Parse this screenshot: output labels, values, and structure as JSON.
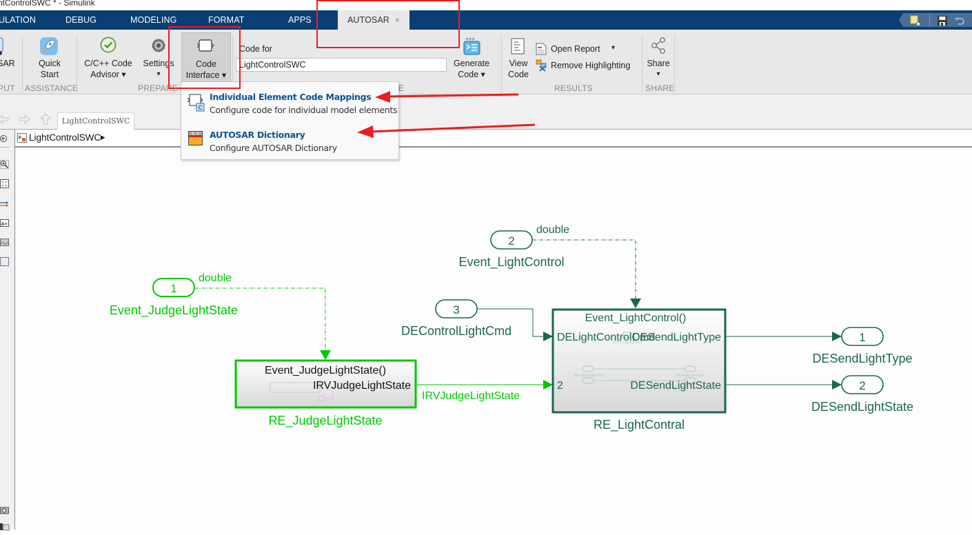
{
  "window": {
    "title": "ntControlSWC * - Simulink"
  },
  "tabs": [
    {
      "label": "ULATION"
    },
    {
      "label": "DEBUG"
    },
    {
      "label": "MODELING"
    },
    {
      "label": "FORMAT"
    },
    {
      "label": "APPS"
    },
    {
      "label": "AUTOSAR",
      "close": "×",
      "active": true
    }
  ],
  "quick_access": [
    {
      "icon": "favorite-icon"
    },
    {
      "icon": "save-icon"
    },
    {
      "icon": "undo-icon"
    }
  ],
  "ribbon": {
    "output_group": {
      "button": "SAR",
      "label": "PUT"
    },
    "assistance_group": {
      "label": "ASSISTANCE",
      "quick_start": [
        "Quick",
        "Start"
      ]
    },
    "prepare_group": {
      "label": "PREPARE",
      "code_advisor": [
        "C/C++ Code",
        "Advisor ▾"
      ],
      "settings": [
        "Settings",
        "▾"
      ],
      "code_interface": [
        "Code",
        "Interface ▾"
      ]
    },
    "generate_group": {
      "code_for_label": "Code for",
      "code_for_value": "LightControlSWC",
      "generate_code": [
        "Generate",
        "Code ▾"
      ],
      "label_fragment": "E"
    },
    "results_group": {
      "label": "RESULTS",
      "view_code": [
        "View",
        "Code"
      ],
      "open_report": "Open Report",
      "open_report_arrow": "▾",
      "remove_highlighting": "Remove Highlighting"
    },
    "share_group": {
      "label": "SHARE",
      "share": [
        "Share",
        "▾"
      ]
    }
  },
  "code_interface_menu": {
    "items": [
      {
        "title": "Individual Element Code Mappings",
        "description": "Configure code for individual model elements"
      },
      {
        "title": "AUTOSAR Dictionary",
        "description": "Configure AUTOSAR Dictionary"
      }
    ]
  },
  "navigation": {
    "model_tab": "LightControlSWC",
    "breadcrumb": "LightControlSWC",
    "breadcrumb_arrow": "▸"
  },
  "diagram": {
    "colors": {
      "bright_green": "#00c800",
      "dark_green": "#1a6650",
      "annotation_red": "#ee1c1c"
    },
    "inports": [
      {
        "number": "1",
        "name": "Event_JudgeLightState",
        "type_label": "double"
      },
      {
        "number": "2",
        "name": "Event_LightControl",
        "type_label": "double"
      },
      {
        "number": "3",
        "name": "DEControlLightCmd"
      }
    ],
    "outports": [
      {
        "number": "1",
        "name": "DESendLightType"
      },
      {
        "number": "2",
        "name": "DESendLightState"
      }
    ],
    "subsystems": [
      {
        "name": "RE_JudgeLightState",
        "trigger": "Event_JudgeLightState()",
        "output_port": "IRVJudgeLightState"
      },
      {
        "name": "RE_LightContral",
        "trigger": "Event_LightControl()",
        "input_port_1": "DELightControlCmd",
        "input_port_2": "2",
        "output_port_1": "DESendLightType",
        "output_port_2": "DESendLightState",
        "mini_labels": [
          "Event_LightControl",
          "DELightControlCmd",
          "DESendLightType"
        ]
      }
    ],
    "signals": [
      {
        "label": "IRVJudgeLightState"
      }
    ]
  }
}
